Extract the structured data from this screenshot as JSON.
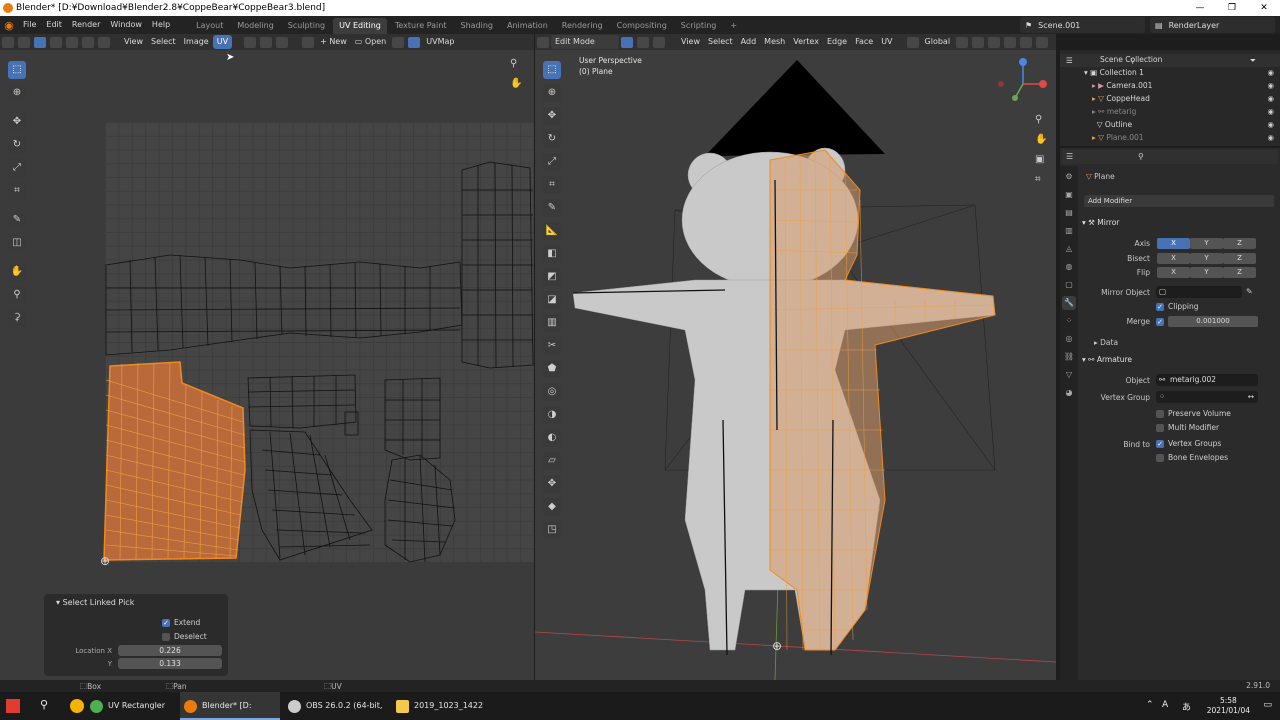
{
  "window": {
    "title": "Blender* [D:¥Download¥Blender2.8¥CoppeBear¥CoppeBear3.blend]",
    "controls": [
      "—",
      "❐",
      "✕"
    ]
  },
  "menu": [
    "File",
    "Edit",
    "Render",
    "Window",
    "Help"
  ],
  "workspaces": [
    {
      "label": "Layout",
      "active": false
    },
    {
      "label": "Modeling",
      "active": false
    },
    {
      "label": "Sculpting",
      "active": false
    },
    {
      "label": "UV Editing",
      "active": true
    },
    {
      "label": "Texture Paint",
      "active": false
    },
    {
      "label": "Shading",
      "active": false
    },
    {
      "label": "Animation",
      "active": false
    },
    {
      "label": "Rendering",
      "active": false
    },
    {
      "label": "Compositing",
      "active": false
    },
    {
      "label": "Scripting",
      "active": false
    }
  ],
  "add_workspace": "+",
  "scene": "Scene.001",
  "view_layer": "RenderLayer",
  "uv_header": {
    "view": "View",
    "select": "Select",
    "image": "Image",
    "uv": "UV",
    "new": "New",
    "open": "Open",
    "uvmap": "UVMap"
  },
  "vp_header": {
    "mode": "Edit Mode",
    "view": "View",
    "select": "Select",
    "add": "Add",
    "mesh": "Mesh",
    "vertex": "Vertex",
    "edge": "Edge",
    "face": "Face",
    "uv": "UV",
    "orientation": "Global"
  },
  "viewport": {
    "perspective": "User Perspective",
    "object": "(0) Plane"
  },
  "operator_panel": {
    "title": "Select Linked Pick",
    "extend_label": "Extend",
    "extend_on": true,
    "deselect_label": "Deselect",
    "deselect_on": false,
    "location_x_label": "Location X",
    "location_x": "0.226",
    "location_y_label": "Y",
    "location_y": "0.133"
  },
  "outliner": {
    "root": "Scene Collection",
    "items": [
      {
        "label": "Collection 1"
      },
      {
        "label": "Camera.001"
      },
      {
        "label": "CoppeHead"
      },
      {
        "label": "metarig"
      },
      {
        "label": "Outline"
      },
      {
        "label": "Plane.001"
      }
    ]
  },
  "properties": {
    "object_name": "Plane",
    "add_modifier": "Add Modifier",
    "mirror": {
      "name": "Mirror",
      "axis_label": "Axis",
      "bisect_label": "Bisect",
      "flip_label": "Flip",
      "x": "X",
      "y": "Y",
      "z": "Z",
      "mirror_object_label": "Mirror Object",
      "clipping_label": "Clipping",
      "merge_label": "Merge",
      "merge_value": "0.001000",
      "data_label": "Data"
    },
    "armature": {
      "name": "Armature",
      "object_label": "Object",
      "object_value": "metarig.002",
      "vertex_group_label": "Vertex Group",
      "preserve_volume": "Preserve Volume",
      "multi_modifier": "Multi Modifier",
      "bind_to_label": "Bind to",
      "vertex_groups": "Vertex Groups",
      "bone_envelopes": "Bone Envelopes"
    }
  },
  "status": {
    "box_select": "Box Select",
    "pan_view": "Pan View",
    "uv_context": "UV Context Menu",
    "version": "2.91.0"
  },
  "taskbar": {
    "items": [
      {
        "label": "UV Rectangler #b3...",
        "color": "#4caf50"
      },
      {
        "label": "Blender* [D:¥Downl...",
        "color": "#e87d0d"
      },
      {
        "label": "OBS 26.0.2 (64-bit, ...",
        "color": "#cccccc"
      },
      {
        "label": "2019_1023_1422",
        "color": "#f2c94c"
      }
    ],
    "ime": "A",
    "time": "5:58",
    "date": "2021/01/04"
  },
  "colors": {
    "accent": "#4772b3",
    "selection": "#e87d0d",
    "uv_fill": "#b96a3a"
  }
}
